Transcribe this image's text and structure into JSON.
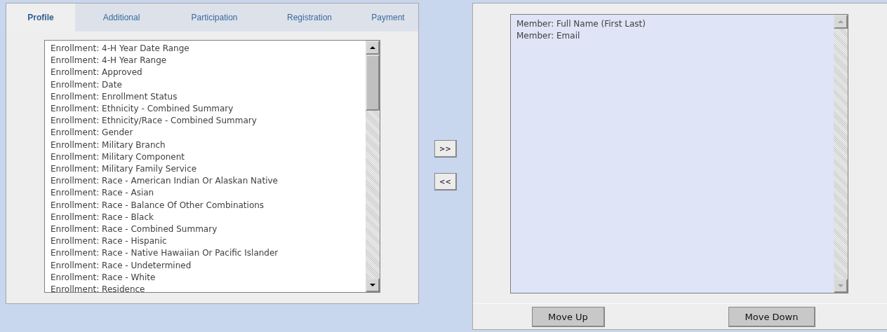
{
  "tabs": [
    {
      "label": "Profile",
      "selected": true
    },
    {
      "label": "Additional",
      "selected": false
    },
    {
      "label": "Participation",
      "selected": false
    },
    {
      "label": "Registration",
      "selected": false
    },
    {
      "label": "Payment",
      "selected": false
    }
  ],
  "available_fields": [
    "Enrollment: 4-H Year Date Range",
    "Enrollment: 4-H Year Range",
    "Enrollment: Approved",
    "Enrollment: Date",
    "Enrollment: Enrollment Status",
    "Enrollment: Ethnicity - Combined Summary",
    "Enrollment: Ethnicity/Race - Combined Summary",
    "Enrollment: Gender",
    "Enrollment: Military Branch",
    "Enrollment: Military Component",
    "Enrollment: Military Family Service",
    "Enrollment: Race - American Indian Or Alaskan Native",
    "Enrollment: Race - Asian",
    "Enrollment: Race - Balance Of Other Combinations",
    "Enrollment: Race - Black",
    "Enrollment: Race - Combined Summary",
    "Enrollment: Race - Hispanic",
    "Enrollment: Race - Native Hawaiian Or Pacific Islander",
    "Enrollment: Race - Undetermined",
    "Enrollment: Race - White",
    "Enrollment: Residence"
  ],
  "transfer_buttons": [
    ">>",
    "<<"
  ],
  "selected_fields": [
    "Member: Full Name (First Last)",
    "Member: Email"
  ],
  "order_buttons": [
    "Move Up",
    "Move Down"
  ]
}
